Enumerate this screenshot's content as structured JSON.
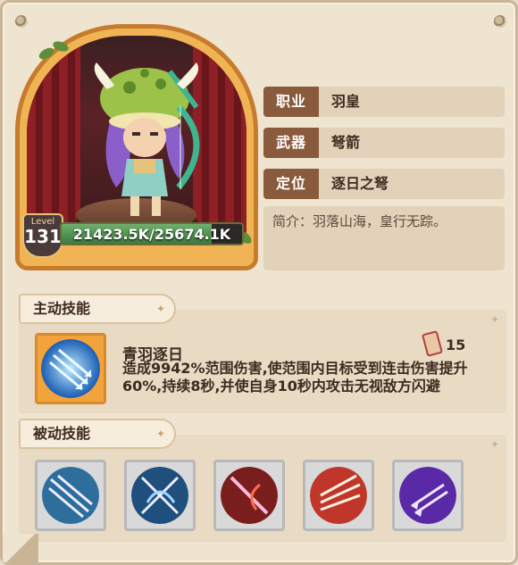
{
  "character": {
    "level_label": "Level",
    "level": "131",
    "hp_text": "21423.5K/25674.1K",
    "hp_fraction": 0.834
  },
  "info": {
    "class_key": "职业",
    "class_value": "羽皇",
    "weapon_key": "武器",
    "weapon_value": "弩箭",
    "role_key": "定位",
    "role_value": "逐日之弩",
    "description": "简介：羽落山海，皇行无踪。"
  },
  "active_skills": {
    "tab_label": "主动技能",
    "skill_name": "青羽逐日",
    "cost": "15",
    "skill_desc": "造成9942%范围伤害,使范围内目标受到连击伤害提升60%,持续8秒,并使自身10秒内攻击无视敌方闪避"
  },
  "passive_skills": {
    "tab_label": "被动技能",
    "icons": [
      "triple-arrow-icon",
      "crossed-arrows-icon",
      "red-arrow-icon",
      "fire-arrows-icon",
      "purple-arrows-icon"
    ]
  },
  "colors": {
    "frame": "#c77b2c",
    "key_bg": "#8a5a3c",
    "hp_green": "#3c7b3d"
  }
}
